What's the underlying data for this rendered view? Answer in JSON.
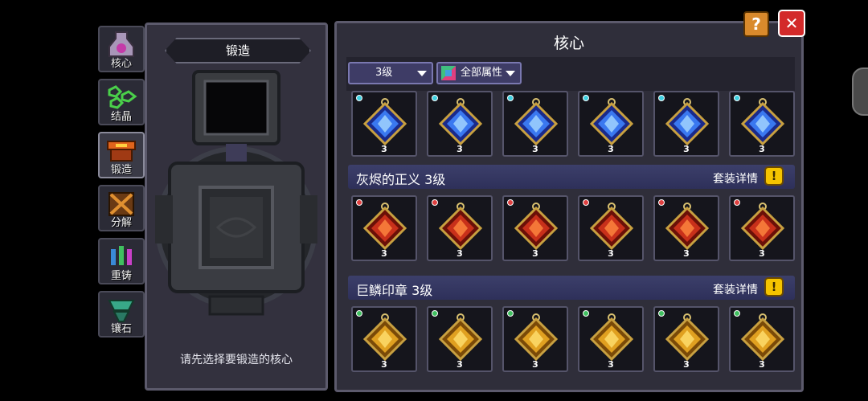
{
  "tabs": [
    {
      "label": "核心",
      "icon": "core-icon",
      "active": false
    },
    {
      "label": "结晶",
      "icon": "crystal-icon",
      "active": false
    },
    {
      "label": "锻造",
      "icon": "forge-icon",
      "active": true
    },
    {
      "label": "分解",
      "icon": "decompose-icon",
      "active": false
    },
    {
      "label": "重铸",
      "icon": "recast-icon",
      "active": false
    },
    {
      "label": "镶石",
      "icon": "inlay-icon",
      "active": false
    }
  ],
  "forge": {
    "title": "锻造",
    "hint": "请先选择要锻造的核心"
  },
  "core": {
    "title": "核心",
    "level_filter": "3级",
    "attr_filter": "全部属性",
    "sections": [
      {
        "title": "",
        "details": "",
        "theme": "blue",
        "level_label": "3",
        "attr_color": "#3fd0e0",
        "count": 6
      },
      {
        "title": "灰烬的正义 3级",
        "details": "套装详情",
        "theme": "red",
        "level_label": "3",
        "attr_color": "#e04040",
        "count": 6
      },
      {
        "title": "巨鳞印章 3级",
        "details": "套装详情",
        "theme": "gold",
        "level_label": "3",
        "attr_color": "#40c060",
        "count": 6
      }
    ]
  },
  "buttons": {
    "help": "?",
    "close": "✕",
    "info": "!"
  },
  "colors": {
    "blue_gem": "#2a5cd8",
    "red_gem": "#b8261a",
    "gold_gem": "#d89a1c",
    "frame": "#c8a040"
  }
}
